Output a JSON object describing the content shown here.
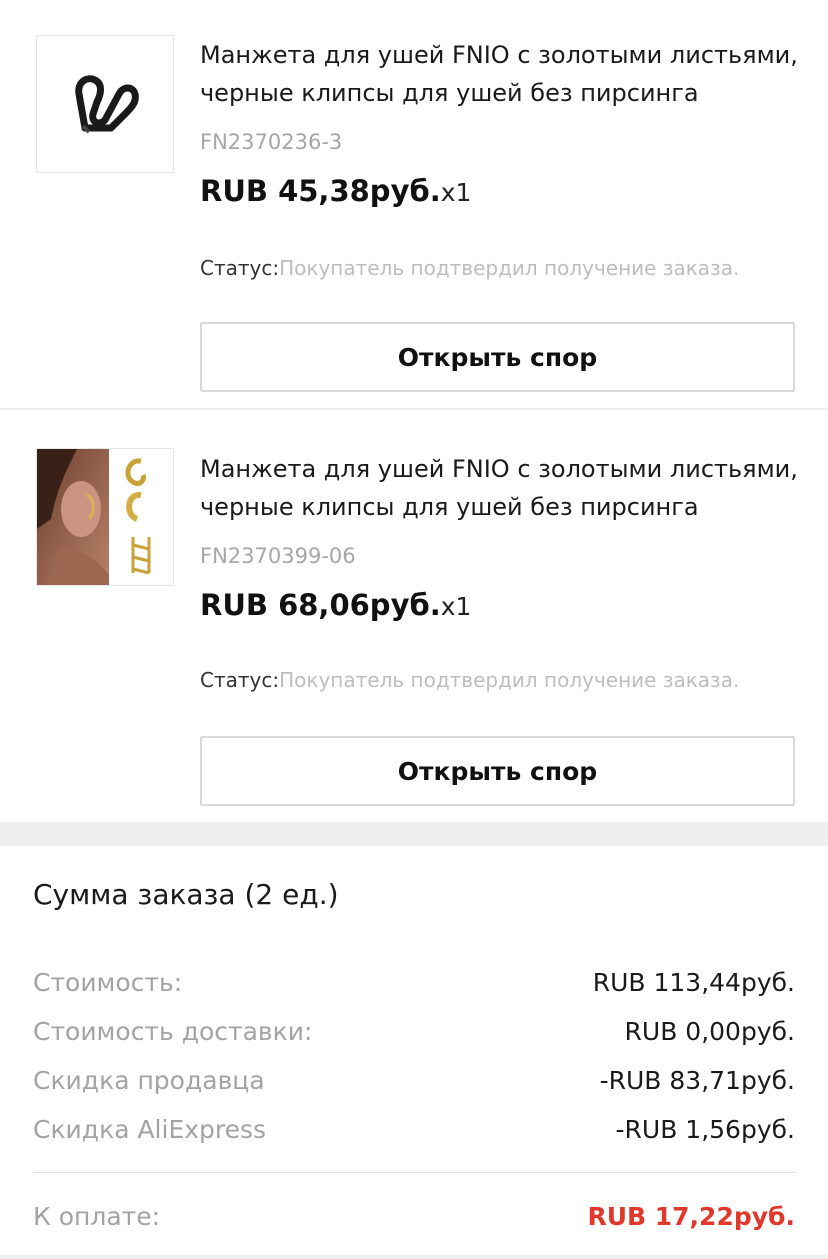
{
  "items": [
    {
      "title": "Манжета для ушей FNIO с золотыми листьями, черные клипсы для ушей без пирсинга",
      "sku": "FN2370236-3",
      "price": "RUB 45,38руб.",
      "qty": "x1",
      "status_label": "Статус:",
      "status_value": "Покупатель подтвердил получение заказа.",
      "dispute_button": "Открыть спор"
    },
    {
      "title": "Манжета для ушей FNIO с золотыми листьями, черные клипсы для ушей без пирсинга",
      "sku": "FN2370399-06",
      "price": "RUB 68,06руб.",
      "qty": "x1",
      "status_label": "Статус:",
      "status_value": "Покупатель подтвердил получение заказа.",
      "dispute_button": "Открыть спор"
    }
  ],
  "summary": {
    "title": "Сумма заказа (2 ед.)",
    "rows": [
      {
        "label": "Стоимость:",
        "value": "RUB 113,44руб."
      },
      {
        "label": "Стоимость доставки:",
        "value": "RUB 0,00руб."
      },
      {
        "label": "Скидка продавца",
        "value": "-RUB 83,71руб."
      },
      {
        "label": "Скидка AliExpress",
        "value": "-RUB 1,56руб."
      }
    ],
    "total_label": "К оплате:",
    "total_value": "RUB 17,22руб."
  },
  "colors": {
    "total": "#e0392b",
    "status_value": "#bdbdbd",
    "muted_label": "#a3a3a3"
  },
  "icons": [
    "ear-cuff-black-product-image",
    "ear-cuff-gold-product-image"
  ]
}
